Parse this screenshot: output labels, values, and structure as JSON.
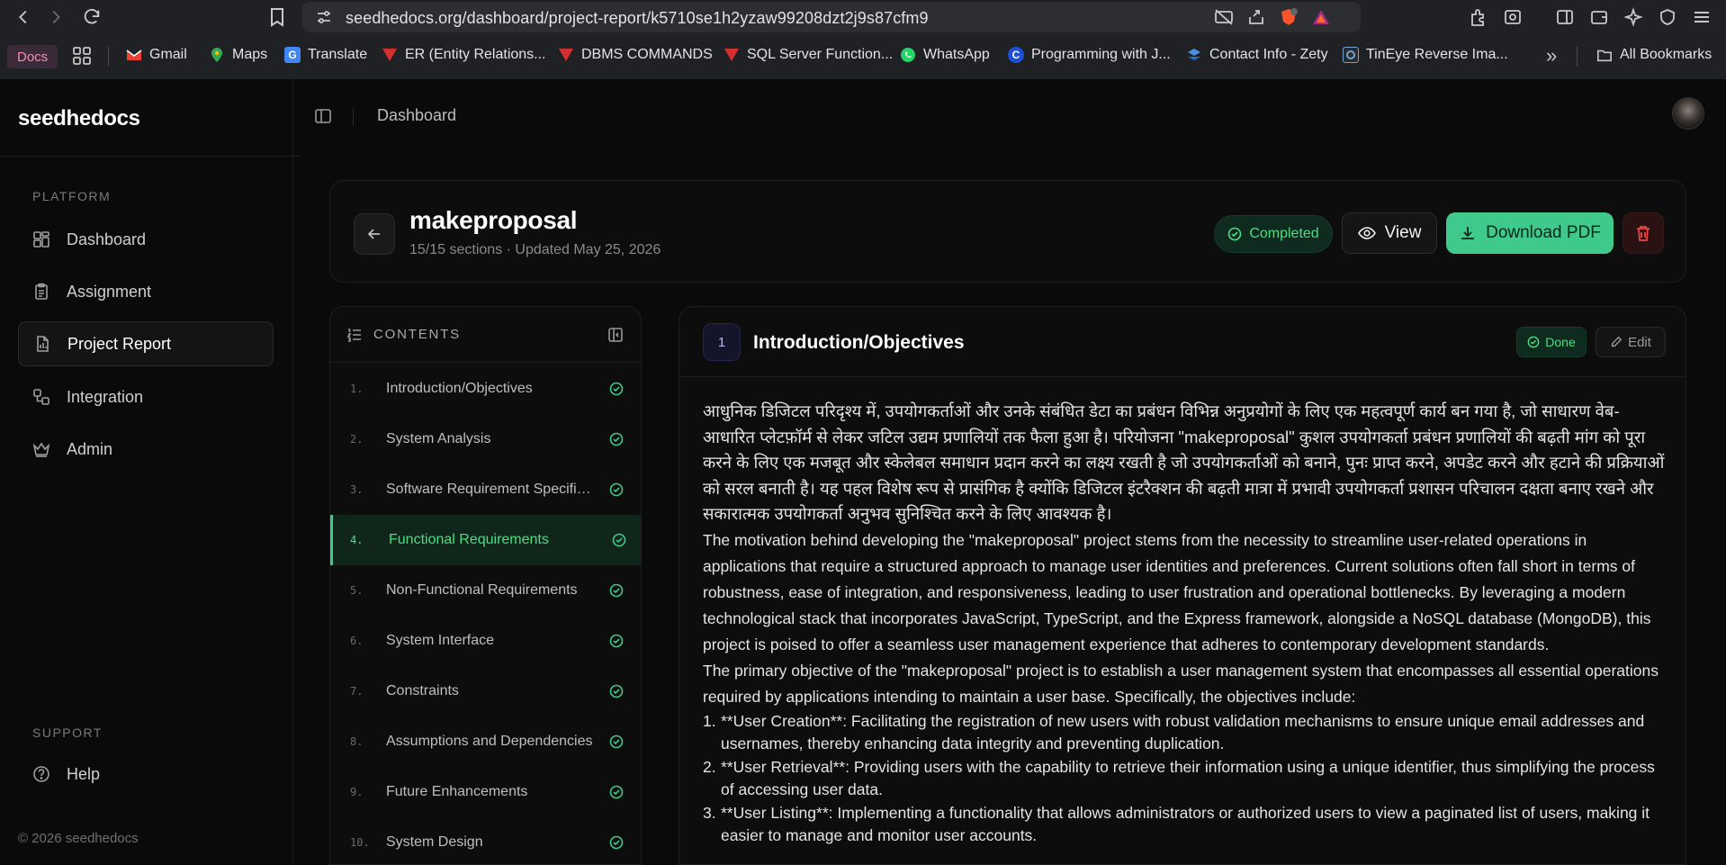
{
  "browser": {
    "url": "seedhedocs.org/dashboard/project-report/k5710se1h2yzaw99208dzt2j9s87cfm9",
    "bookmarks": {
      "docs": "Docs",
      "items": [
        "Gmail",
        "Maps",
        "Translate",
        "ER (Entity Relations...",
        "DBMS COMMANDS",
        "SQL Server Function...",
        "WhatsApp",
        "Programming with J...",
        "Contact Info - Zety",
        "TinEye Reverse Ima..."
      ],
      "overflow": "»",
      "all_bookmarks": "All Bookmarks"
    }
  },
  "sidebar": {
    "brand": "seedhedocs",
    "platform_label": "PLATFORM",
    "items": [
      {
        "label": "Dashboard",
        "icon": "layout-grid-icon"
      },
      {
        "label": "Assignment",
        "icon": "clipboard-icon"
      },
      {
        "label": "Project Report",
        "icon": "file-text-icon",
        "active": true
      },
      {
        "label": "Integration",
        "icon": "workflow-icon"
      },
      {
        "label": "Admin",
        "icon": "crown-icon"
      }
    ],
    "support_label": "SUPPORT",
    "help": "Help",
    "copyright": "© 2026 seedhedocs"
  },
  "topbar": {
    "title": "Dashboard"
  },
  "project": {
    "title": "makeproposal",
    "meta": "15/15 sections · Updated May 25, 2026",
    "status": "Completed",
    "view_label": "View",
    "download_label": "Download PDF"
  },
  "toc": {
    "heading": "CONTENTS",
    "items": [
      {
        "num": "1.",
        "label": "Introduction/Objectives"
      },
      {
        "num": "2.",
        "label": "System Analysis"
      },
      {
        "num": "3.",
        "label": "Software Requirement Specific..."
      },
      {
        "num": "4.",
        "label": "Functional Requirements",
        "active": true
      },
      {
        "num": "5.",
        "label": "Non-Functional Requirements"
      },
      {
        "num": "6.",
        "label": "System Interface"
      },
      {
        "num": "7.",
        "label": "Constraints"
      },
      {
        "num": "8.",
        "label": "Assumptions and Dependencies"
      },
      {
        "num": "9.",
        "label": "Future Enhancements"
      },
      {
        "num": "10.",
        "label": "System Design"
      }
    ]
  },
  "section": {
    "number": "1",
    "title": "Introduction/Objectives",
    "status": "Done",
    "edit_label": "Edit",
    "paragraphs": [
      "आधुनिक डिजिटल परिदृश्य में, उपयोगकर्ताओं और उनके संबंधित डेटा का प्रबंधन विभिन्न अनुप्रयोगों के लिए एक महत्वपूर्ण कार्य बन गया है, जो साधारण वेब-आधारित प्लेटफ़ॉर्म से लेकर जटिल उद्यम प्रणालियों तक फैला हुआ है। परियोजना \"makeproposal\" कुशल उपयोगकर्ता प्रबंधन प्रणालियों की बढ़ती मांग को पूरा करने के लिए एक मजबूत और स्केलेबल समाधान प्रदान करने का लक्ष्य रखती है जो उपयोगकर्ताओं को बनाने, पुनः प्राप्त करने, अपडेट करने और हटाने की प्रक्रियाओं को सरल बनाती है। यह पहल विशेष रूप से प्रासंगिक है क्योंकि डिजिटल इंटरैक्शन की बढ़ती मात्रा में प्रभावी उपयोगकर्ता प्रशासन परिचालन दक्षता बनाए रखने और सकारात्मक उपयोगकर्ता अनुभव सुनिश्चित करने के लिए आवश्यक है।",
      "The motivation behind developing the \"makeproposal\" project stems from the necessity to streamline user-related operations in applications that require a structured approach to manage user identities and preferences. Current solutions often fall short in terms of robustness, ease of integration, and responsiveness, leading to user frustration and operational bottlenecks. By leveraging a modern technological stack that incorporates JavaScript, TypeScript, and the Express framework, alongside a NoSQL database (MongoDB), this project is poised to offer a seamless user management experience that adheres to contemporary development standards.",
      "The primary objective of the \"makeproposal\" project is to establish a user management system that encompasses all essential operations required by applications intending to maintain a user base. Specifically, the objectives include:"
    ],
    "list": [
      {
        "n": "1.",
        "text": "**User Creation**: Facilitating the registration of new users with robust validation mechanisms to ensure unique email addresses and usernames, thereby enhancing data integrity and preventing duplication."
      },
      {
        "n": "2.",
        "text": "**User Retrieval**: Providing users with the capability to retrieve their information using a unique identifier, thus simplifying the process of accessing user data."
      },
      {
        "n": "3.",
        "text": "**User Listing**: Implementing a functionality that allows administrators or authorized users to view a paginated list of users, making it easier to manage and monitor user accounts."
      }
    ]
  }
}
